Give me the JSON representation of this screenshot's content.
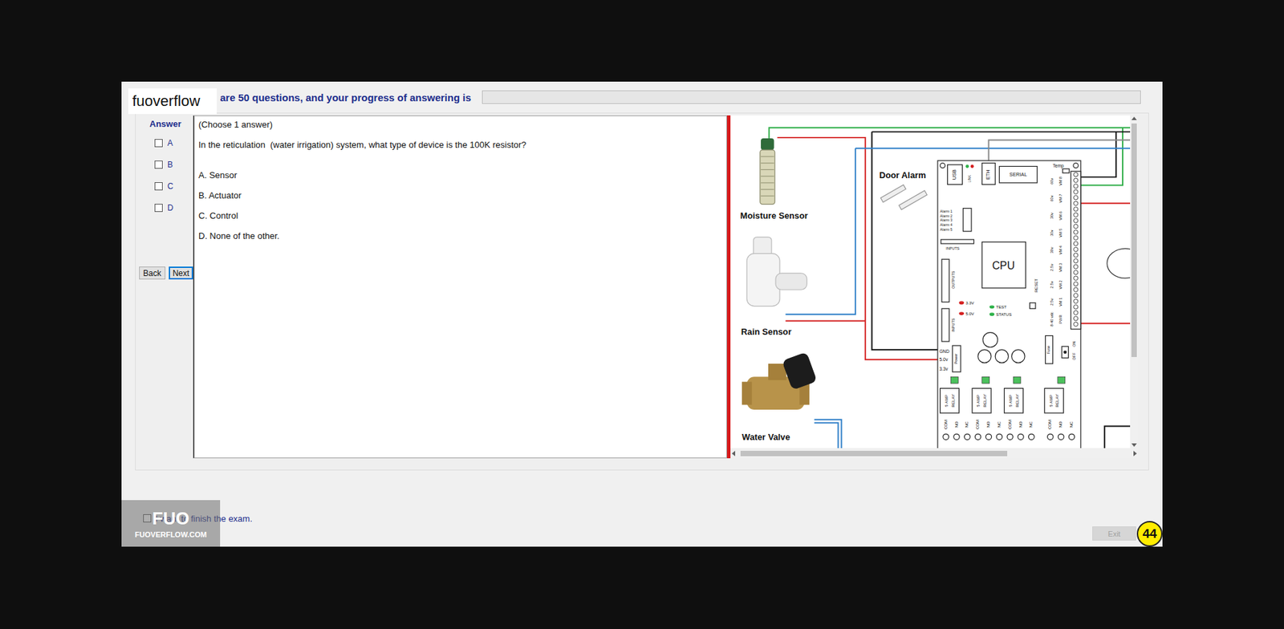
{
  "header": {
    "logo": "fuoverflow",
    "text": "are 50 questions, and your progress of answering is",
    "progress": {
      "level": 0
    }
  },
  "answer_panel": {
    "title": "Answer",
    "options": [
      {
        "label": "A",
        "checked": false
      },
      {
        "label": "B",
        "checked": false
      },
      {
        "label": "C",
        "checked": false
      },
      {
        "label": "D",
        "checked": false
      }
    ]
  },
  "nav_buttons": [
    {
      "label": "Back",
      "focused": false
    },
    {
      "label": "Next",
      "focused": true
    }
  ],
  "question": {
    "instruction": "(Choose 1 answer)",
    "text": "In the reticulation  (water irrigation) system, what type of device is the 100K resistor?",
    "choices": [
      "A. Sensor",
      "B. Actuator",
      "C. Control",
      "D. None of the other."
    ]
  },
  "diagram": {
    "devices": [
      "Moisture Sensor",
      "Rain Sensor",
      "Water Valve"
    ],
    "door_alarm": "Door Alarm",
    "board": {
      "ports": [
        "USB",
        "ETH",
        "SERIAL"
      ],
      "link": "LINK",
      "temp": "Temp",
      "alarms": [
        "Alarm 1",
        "Alarm 2",
        "Alarm 3",
        "Alarm 4",
        "Alarm 5"
      ],
      "headers": [
        "INPUTS",
        "OUTPUTS",
        "INPUTS"
      ],
      "cpu": "CPU",
      "leds": [
        {
          "label": "3.3V",
          "color": "#d42020"
        },
        {
          "label": "5.0V",
          "color": "#d42020"
        },
        {
          "label": "TEST",
          "color": "#2fb24a"
        },
        {
          "label": "STATUS",
          "color": "#2fb24a"
        }
      ],
      "reset": "RESET",
      "power_pins": [
        "GND",
        "5.0v",
        "3.3v"
      ],
      "power": "Power",
      "fuse": "Fuse",
      "switch": [
        "ON",
        "OFF"
      ],
      "relays": [
        {
          "lines": [
            "5 AMP",
            "RELAY"
          ],
          "terminals": [
            "COM",
            "NO",
            "NC"
          ]
        },
        {
          "lines": [
            "5 AMP",
            "RELAY"
          ],
          "terminals": [
            "COM",
            "NO",
            "NC"
          ]
        },
        {
          "lines": [
            "5 AMP",
            "RELAY"
          ],
          "terminals": [
            "COM",
            "NO",
            "NC"
          ]
        },
        {
          "lines": [
            "5 AMP",
            "RELAY"
          ],
          "terminals": [
            "COM",
            "NO",
            "NC"
          ]
        }
      ],
      "channels": [
        {
          "voltage": "60v",
          "channel": "VM 8"
        },
        {
          "voltage": "60v",
          "channel": "VM 7"
        },
        {
          "voltage": "30v",
          "channel": "VM 6"
        },
        {
          "voltage": "30v",
          "channel": "VM 5"
        },
        {
          "voltage": "30v",
          "channel": "VM 4"
        },
        {
          "voltage": "2.5v",
          "channel": "VM 3"
        },
        {
          "voltage": "2.5v",
          "channel": "VM 2"
        },
        {
          "voltage": "2.5v",
          "channel": "VM 1"
        },
        {
          "voltage": "8-40 vdc",
          "channel": "PWR"
        }
      ]
    }
  },
  "footer": {
    "finish": {
      "label": "I want to finish the exam.",
      "checked": false
    },
    "exit": {
      "label": "Exit",
      "disabled": true
    },
    "badge": "44",
    "watermark": {
      "mark": "FUO",
      "site": "FUOVERFLOW.COM"
    }
  }
}
